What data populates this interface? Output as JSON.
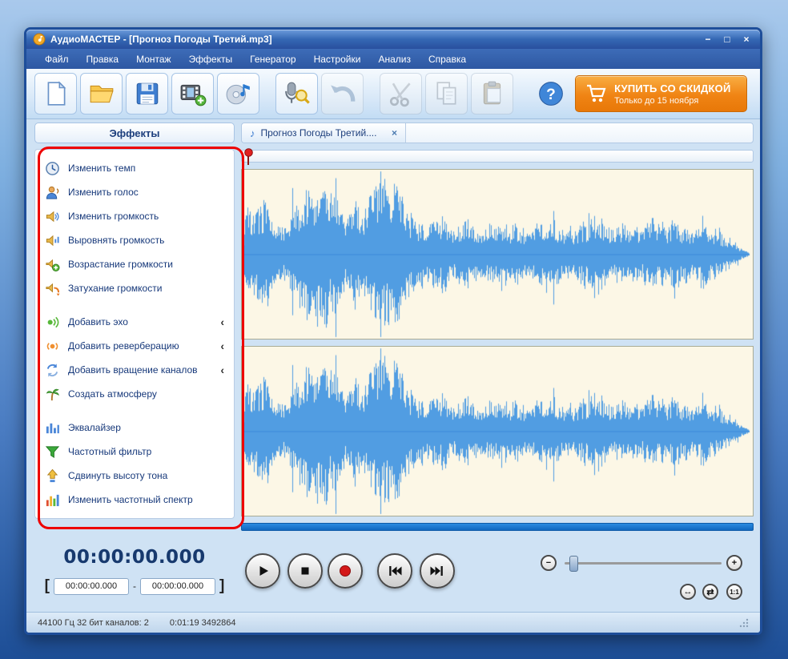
{
  "window": {
    "title": "АудиоМАСТЕР - [Прогноз Погоды Третий.mp3]",
    "app_icon": "app-note-icon",
    "minimize": "−",
    "maximize": "□",
    "close": "×"
  },
  "menu": {
    "items": [
      "Файл",
      "Правка",
      "Монтаж",
      "Эффекты",
      "Генератор",
      "Настройки",
      "Анализ",
      "Справка"
    ]
  },
  "toolbar": {
    "buttons": [
      {
        "name": "new-file",
        "icon": "new-file-icon"
      },
      {
        "name": "open-file",
        "icon": "open-folder-icon"
      },
      {
        "name": "save-file",
        "icon": "save-icon"
      },
      {
        "name": "audio-from-video",
        "icon": "film-plus-icon"
      },
      {
        "name": "grab-from-cd",
        "icon": "cd-note-icon"
      },
      {
        "name": "record-voice",
        "icon": "record-search-icon"
      },
      {
        "name": "undo",
        "icon": "undo-icon"
      },
      {
        "name": "cut",
        "icon": "scissors-icon"
      },
      {
        "name": "copy",
        "icon": "copy-icon"
      },
      {
        "name": "paste",
        "icon": "paste-icon"
      },
      {
        "name": "help",
        "icon": "help-icon"
      }
    ],
    "buy_button": {
      "icon": "cart-icon",
      "title": "КУПИТЬ СО СКИДКОЙ",
      "subtitle": "Только до 15 ноября"
    }
  },
  "effects_panel": {
    "title": "Эффекты",
    "submenu_arrow": "‹",
    "items": [
      {
        "label": "Изменить темп",
        "icon": "tempo-icon"
      },
      {
        "label": "Изменить голос",
        "icon": "voice-icon"
      },
      {
        "label": "Изменить громкость",
        "icon": "volume-icon"
      },
      {
        "label": "Выровнять громкость",
        "icon": "normalize-icon"
      },
      {
        "label": "Возрастание громкости",
        "icon": "fade-in-icon"
      },
      {
        "label": "Затухание громкости",
        "icon": "fade-out-icon"
      },
      {
        "label": "Добавить эхо",
        "icon": "echo-icon",
        "submenu": true
      },
      {
        "label": "Добавить реверберацию",
        "icon": "reverb-icon",
        "submenu": true
      },
      {
        "label": "Добавить вращение каналов",
        "icon": "rotate-icon",
        "submenu": true
      },
      {
        "label": "Создать атмосферу",
        "icon": "atmosphere-icon"
      },
      {
        "label": "Эквалайзер",
        "icon": "equalizer-icon"
      },
      {
        "label": "Частотный фильтр",
        "icon": "filter-icon"
      },
      {
        "label": "Сдвинуть высоту тона",
        "icon": "pitch-icon"
      },
      {
        "label": "Изменить частотный спектр",
        "icon": "spectrum-icon"
      }
    ]
  },
  "document": {
    "tab": {
      "icon": "music-note-icon",
      "label": "Прогноз Погоды Третий....",
      "close": "×"
    }
  },
  "time_panel": {
    "current": "00:00:00.000",
    "bracket_left": "[",
    "selection_start": "00:00:00.000",
    "separator": "-",
    "selection_end": "00:00:00.000",
    "bracket_right": "]"
  },
  "transport": {
    "buttons": [
      {
        "name": "play",
        "icon": "play-icon"
      },
      {
        "name": "stop",
        "icon": "stop-icon"
      },
      {
        "name": "record",
        "icon": "record-dot-icon"
      },
      {
        "name": "skip-to-start",
        "icon": "skip-start-icon"
      },
      {
        "name": "skip-to-end",
        "icon": "skip-end-icon"
      }
    ],
    "volume_minus": "−",
    "volume_plus": "+"
  },
  "zoom_controls": {
    "arrows_horizontal": "↔",
    "swap": "⇄",
    "one_to_one": "1:1"
  },
  "status_bar": {
    "format": "44100 Гц 32 бит каналов: 2",
    "position": "0:01:19 3492864"
  },
  "colors": {
    "waveform": "#519de2",
    "waveform_bg": "#fcf7e6",
    "accent_orange": "#f08414",
    "annotation_red": "#ee0000"
  }
}
